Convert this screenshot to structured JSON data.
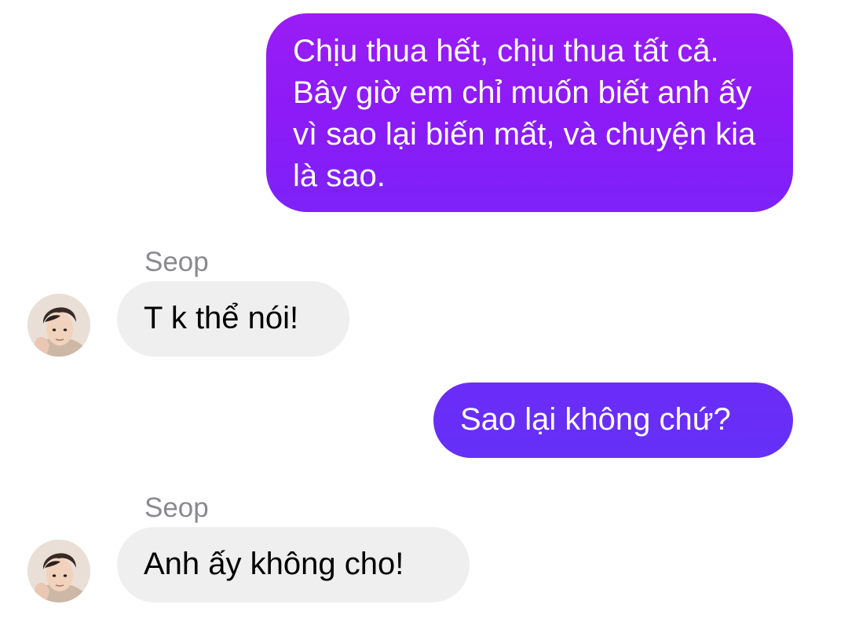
{
  "conversation": {
    "messages": [
      {
        "direction": "outgoing",
        "text": "Chịu thua hết, chịu thua tất cả. Bây giờ em chỉ muốn biết anh ấy vì sao lại biến mất, và chuyện kia là sao."
      },
      {
        "direction": "incoming",
        "sender": "Seop",
        "text": "T k thể nói!"
      },
      {
        "direction": "outgoing",
        "text": "Sao lại không chứ?"
      },
      {
        "direction": "incoming",
        "sender": "Seop",
        "text": "Anh ấy không cho!"
      }
    ]
  },
  "colors": {
    "outgoing_bubble_top": "#9a1cf6",
    "outgoing_bubble_bottom": "#6530f8",
    "incoming_bubble": "#efefef",
    "sender_name": "#8a8a8e"
  },
  "icons": {
    "avatar": "contact-photo"
  }
}
